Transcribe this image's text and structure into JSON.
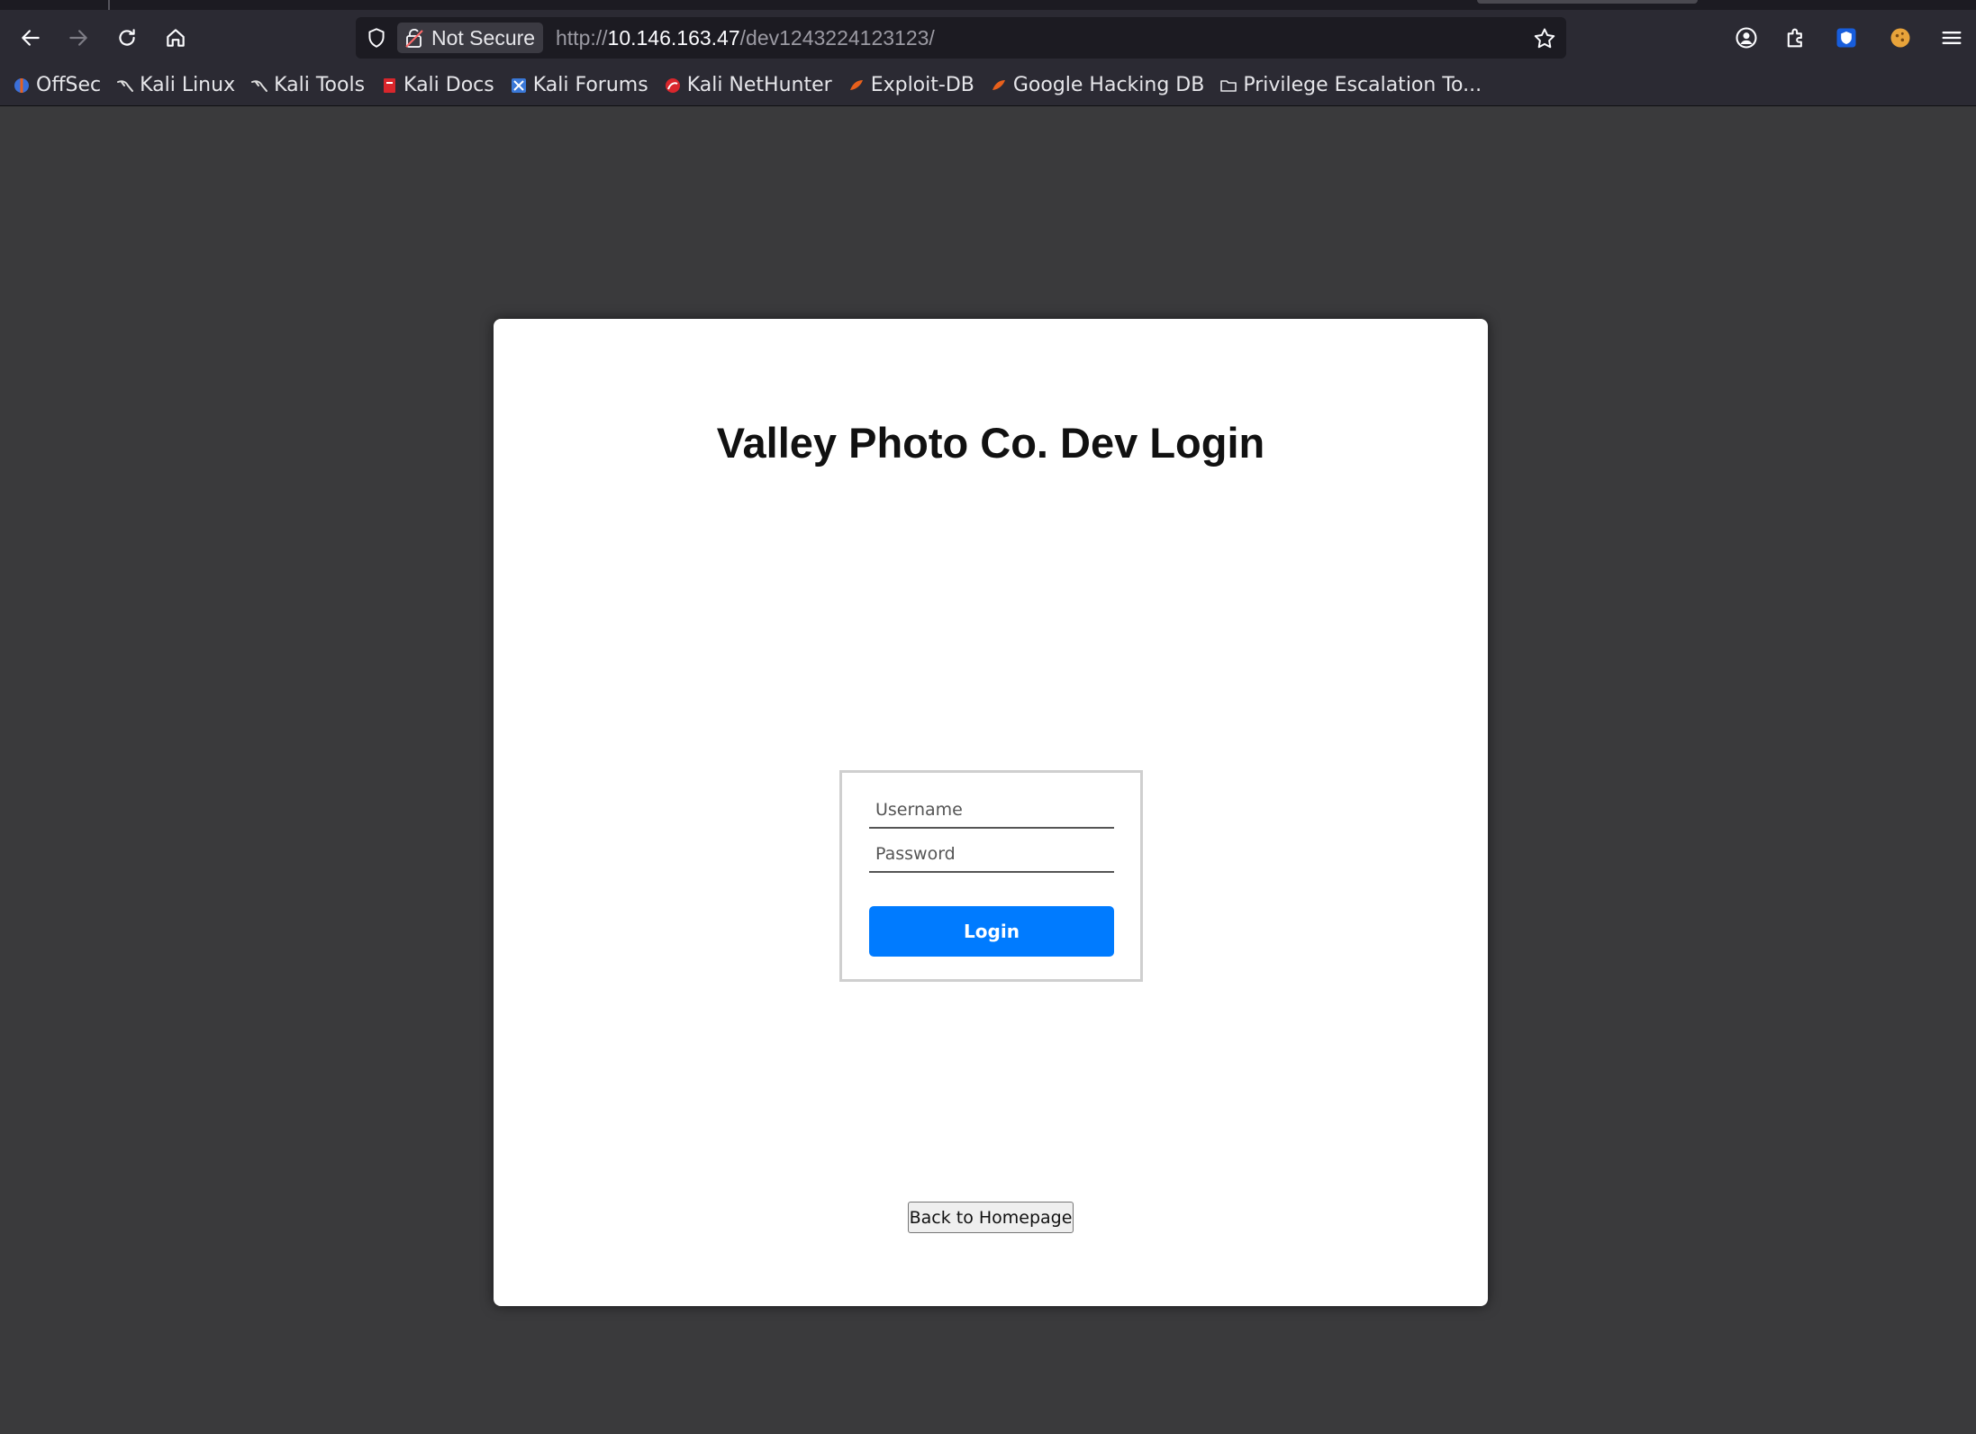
{
  "browser": {
    "security_label": "Not Secure",
    "url_scheme": "http://",
    "url_host": "10.146.163.47",
    "url_path": "/dev1243224123123/"
  },
  "bookmarks": [
    {
      "label": "OffSec",
      "icon": "offsec-icon",
      "color": "#3b6fd8"
    },
    {
      "label": "Kali Linux",
      "icon": "kali-dragon-icon",
      "color": "#cccccc"
    },
    {
      "label": "Kali Tools",
      "icon": "kali-dragon-icon",
      "color": "#cccccc"
    },
    {
      "label": "Kali Docs",
      "icon": "kali-docs-icon",
      "color": "#d9262c"
    },
    {
      "label": "Kali Forums",
      "icon": "kali-forums-icon",
      "color": "#3a78d8"
    },
    {
      "label": "Kali NetHunter",
      "icon": "nethunter-icon",
      "color": "#d9262c"
    },
    {
      "label": "Exploit-DB",
      "icon": "exploit-db-icon",
      "color": "#e8601c"
    },
    {
      "label": "Google Hacking DB",
      "icon": "ghdb-icon",
      "color": "#e8601c"
    },
    {
      "label": "Privilege Escalation To...",
      "icon": "folder-icon",
      "color": "#e6e6ea"
    }
  ],
  "login": {
    "title": "Valley Photo Co. Dev Login",
    "username_placeholder": "Username",
    "password_placeholder": "Password",
    "login_label": "Login",
    "back_label": "Back to Homepage"
  },
  "colors": {
    "accent": "#007bff",
    "page_background": "#3a3a3c",
    "toolbar": "#2b2a33"
  }
}
